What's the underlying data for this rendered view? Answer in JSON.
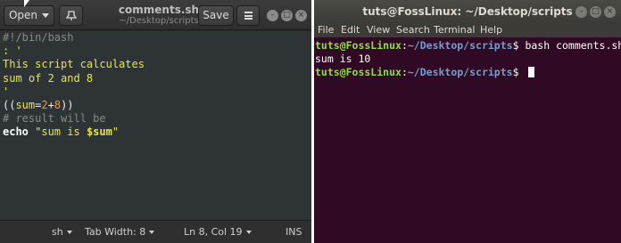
{
  "gedit": {
    "open_label": "Open",
    "title": "comments.sh",
    "subtitle": "~/Desktop/scripts",
    "save_label": "Save",
    "icons": {
      "pin": "document-pin-icon",
      "menu": "hamburger-menu-icon",
      "minimize": "minimize-icon",
      "maximize": "maximize-icon",
      "close": "close-icon"
    },
    "code": {
      "line1": "#!/bin/bash",
      "line2": ": '",
      "line3": "This script calculates",
      "line4": "sum of 2 and 8",
      "line5": "'",
      "line6_open": "((",
      "line6_var": "sum",
      "line6_eq": "=",
      "line6_a": "2",
      "line6_plus": "+",
      "line6_b": "8",
      "line6_close": "))",
      "line7": "# result will be",
      "line8_kw": "echo",
      "line8_str_open": " \"sum is ",
      "line8_var": "$sum",
      "line8_str_close": "\""
    },
    "status": {
      "language": "sh",
      "tab_width": "Tab Width: 8",
      "position": "Ln 8, Col 19",
      "mode": "INS"
    },
    "colors": {
      "editor_bg": "#2e3436",
      "string": "#e7e744",
      "comment": "#888a85",
      "number": "#e79c44"
    }
  },
  "terminal": {
    "title": "tuts@FossLinux: ~/Desktop/scripts",
    "menu": [
      "File",
      "Edit",
      "View",
      "Search",
      "Terminal",
      "Help"
    ],
    "lines": {
      "prompt1_user": "tuts@FossLinux",
      "prompt1_sep": ":",
      "prompt1_path": "~/Desktop/scripts",
      "prompt1_dollar": "$ ",
      "prompt1_cmd": "bash comments.sh",
      "output": "sum is 10",
      "prompt2_user": "tuts@FossLinux",
      "prompt2_sep": ":",
      "prompt2_path": "~/Desktop/scripts",
      "prompt2_dollar": "$ "
    },
    "colors": {
      "background": "#300a24",
      "user": "#8ae234",
      "path": "#729fcf"
    }
  }
}
